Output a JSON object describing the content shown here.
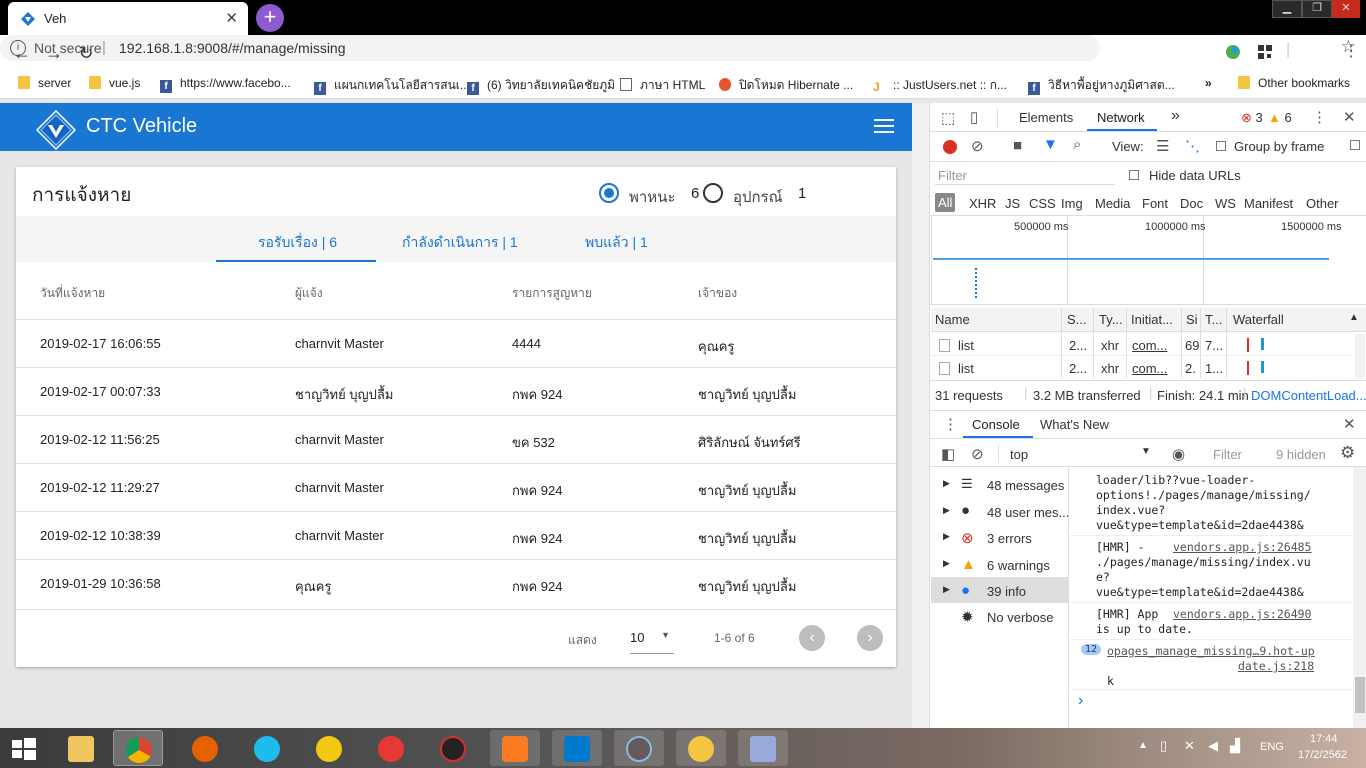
{
  "browser": {
    "tab_title": "Veh",
    "url_secure_label": "Not secure",
    "url": "192.168.1.8:9008/#/manage/missing",
    "bookmarks": [
      {
        "label": "server",
        "icon": "folder-icon"
      },
      {
        "label": "vue.js",
        "icon": "folder-icon"
      },
      {
        "label": "https://www.facebo...",
        "icon": "facebook-icon"
      },
      {
        "label": "แผนกเทคโนโลยีสารสนเ...",
        "icon": "facebook-icon"
      },
      {
        "label": "(6) วิทยาลัยเทคนิคชัยภูมิ",
        "icon": "facebook-icon"
      },
      {
        "label": "ภาษา HTML",
        "icon": "document-icon"
      },
      {
        "label": "ปิดโหมด Hibernate ...",
        "icon": "info-icon"
      },
      {
        "label": ":: JustUsers.net :: ก...",
        "icon": "j-icon"
      },
      {
        "label": "วิธีหาพื้อยู่หางภูมิศาสต...",
        "icon": "facebook-icon"
      },
      {
        "label": "Other bookmarks",
        "icon": "folder-icon"
      }
    ]
  },
  "app": {
    "title": "CTC Vehicle",
    "page_title": "การแจ้งหาย",
    "filters": [
      {
        "label": "พาหนะ",
        "count": "6",
        "selected": true
      },
      {
        "label": "อุปกรณ์",
        "count": "1",
        "selected": false
      }
    ],
    "tabs": [
      {
        "label": "รอรับเรื่อง | 6",
        "active": true
      },
      {
        "label": "กำลังดำเนินการ | 1",
        "active": false
      },
      {
        "label": "พบแล้ว | 1",
        "active": false
      }
    ],
    "columns": [
      "วันที่แจ้งหาย",
      "ผู้แจ้ง",
      "รายการสูญหาย",
      "เจ้าของ"
    ],
    "rows": [
      [
        "2019-02-17 16:06:55",
        "charnvit Master",
        "4444",
        "คุณครู"
      ],
      [
        "2019-02-17 00:07:33",
        "ชาญวิทย์ บุญปลื้ม",
        "กพค 924",
        "ชาญวิทย์ บุญปลื้ม"
      ],
      [
        "2019-02-12 11:56:25",
        "charnvit Master",
        "ขค 532",
        "ศิริลักษณ์ จันทร์ศรี"
      ],
      [
        "2019-02-12 11:29:27",
        "charnvit Master",
        "กพค 924",
        "ชาญวิทย์ บุญปลื้ม"
      ],
      [
        "2019-02-12 10:38:39",
        "charnvit Master",
        "กพค 924",
        "ชาญวิทย์ บุญปลื้ม"
      ],
      [
        "2019-01-29 10:36:58",
        "คุณครู",
        "กพค 924",
        "ชาญวิทย์ บุญปลื้ม"
      ]
    ],
    "footer": {
      "rows_label": "แสดง",
      "rows_per_page": "10",
      "range": "1-6 of 6"
    }
  },
  "devtools": {
    "tabs": [
      "Elements",
      "Network"
    ],
    "active_tab": "Network",
    "error_count": "3",
    "warning_count": "6",
    "view_label": "View:",
    "group_by_frame": "Group by frame",
    "filter_placeholder": "Filter",
    "hide_data_urls": "Hide data URLs",
    "type_filters": [
      "All",
      "XHR",
      "JS",
      "CSS",
      "Img",
      "Media",
      "Font",
      "Doc",
      "WS",
      "Manifest",
      "Other"
    ],
    "timeline_ticks": [
      "500000 ms",
      "1000000 ms",
      "1500000 ms"
    ],
    "net_columns": [
      "Name",
      "S...",
      "Ty...",
      "Initiat...",
      "Si",
      "T...",
      "Waterfall"
    ],
    "net_rows": [
      [
        "list",
        "2...",
        "xhr",
        "com...",
        "69",
        "7..."
      ],
      [
        "list",
        "2...",
        "xhr",
        "com...",
        "2.",
        "1..."
      ]
    ],
    "summary": {
      "requests": "31 requests",
      "transferred": "3.2 MB transferred",
      "finish": "Finish: 24.1 min",
      "dcl": "DOMContentLoad..."
    },
    "drawer_tabs": [
      "Console",
      "What's New"
    ],
    "context": "top",
    "console_filter": "Filter",
    "hidden": "9 hidden",
    "sidebar": [
      {
        "label": "48 messages",
        "icon": "list-icon"
      },
      {
        "label": "48 user mes...",
        "icon": "user-icon"
      },
      {
        "label": "3 errors",
        "icon": "error-icon"
      },
      {
        "label": "6 warnings",
        "icon": "warning-icon"
      },
      {
        "label": "39 info",
        "icon": "info-icon"
      },
      {
        "label": "No verbose",
        "icon": "bug-icon"
      }
    ],
    "console_lines": {
      "l1": "loader/lib??vue-loader-",
      "l2": "options!./pages/manage/missing/",
      "l3": "index.vue?",
      "l4": "vue&type=template&id=2dae4438&",
      "hmr1_prefix": "[HMR]  -",
      "hmr1_link": "vendors.app.js:26485",
      "hmr1_l2": "./pages/manage/missing/index.vu",
      "hmr1_l3": "e?",
      "hmr1_l4": "vue&type=template&id=2dae4438&",
      "hmr2_prefix": "[HMR] App",
      "hmr2_link": "vendors.app.js:26490",
      "hmr2_l2": "is up to date.",
      "group_count": "12",
      "group_text": "opages_manage_missing…9.hot-up",
      "group_link": "date.js:218",
      "k": "k",
      "prompt": "›"
    }
  },
  "taskbar": {
    "lang": "ENG",
    "time": "17:44",
    "date": "17/2/2562"
  }
}
